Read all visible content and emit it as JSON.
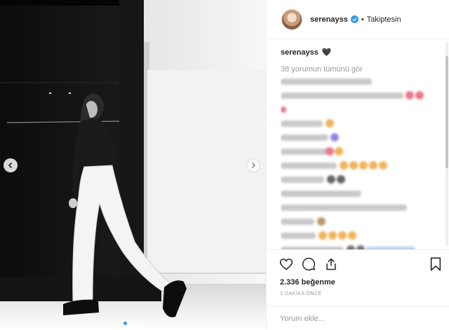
{
  "post": {
    "username": "serenayss",
    "follow_status": "Takiptesin",
    "separator": "•",
    "caption_user": "serenayss",
    "caption_emoji": "🖤",
    "view_all_comments": "38 yorumun tümünü gör",
    "likes": "2.336 beğenme",
    "timestamp": "3 DAKİKA ÖNCE",
    "comment_placeholder": "Yorum ekle..."
  },
  "carousel": {
    "total_slides": 4,
    "active_slide": 1
  },
  "icons": {
    "prev": "chevron-left-icon",
    "next": "chevron-right-icon",
    "verified": "verified-badge-icon",
    "like": "heart-icon",
    "comment": "comment-icon",
    "share": "share-icon",
    "save": "bookmark-icon"
  },
  "colors": {
    "verified_blue": "#3897f0",
    "text": "#262626",
    "muted": "#999999"
  }
}
